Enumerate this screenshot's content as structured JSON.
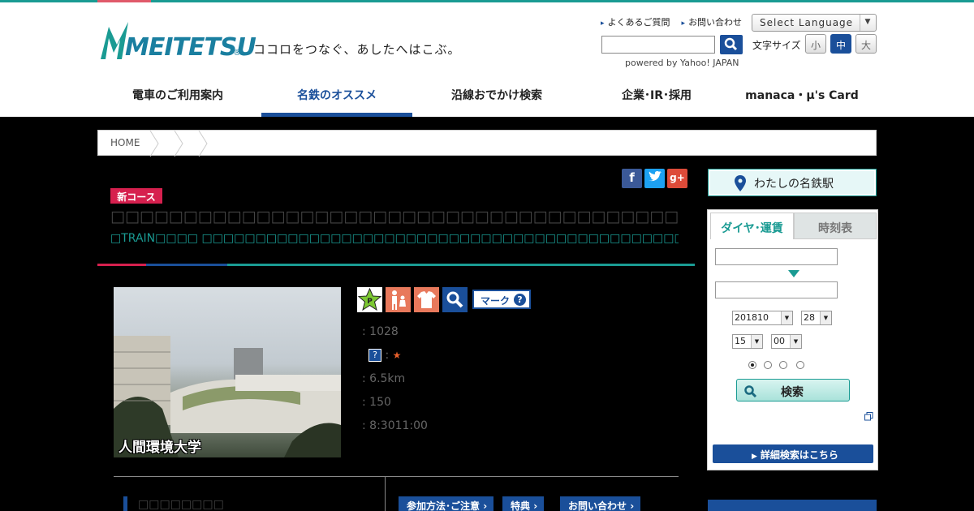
{
  "header": {
    "logo_text": "MEITETSU",
    "logo_reg": "®",
    "tagline": "ココロをつなぐ、あしたへはこぶ。",
    "links": [
      "よくあるご質問",
      "お問い合わせ"
    ],
    "language_label": "Select Language",
    "powered_by": "powered by Yahoo! JAPAN",
    "font_size_label": "文字サイズ",
    "font_sizes": [
      "小",
      "中",
      "大"
    ],
    "brand_color": "#1a4f9a",
    "accent_color": "#1a9b93"
  },
  "nav": {
    "items": [
      "電車のご利用案内",
      "名鉄のオススメ",
      "沿線おでかけ検索",
      "企業･IR･採用",
      "manaca・μ's Card"
    ],
    "active_index": 1
  },
  "breadcrumb": {
    "home": "HOME"
  },
  "course": {
    "badge": "新コース",
    "title": "□□□□□□□□□□□□□□□□□□□□□□□□□□□□□□□□□□□□□□□□□□□□□□□□□□",
    "subtitle": "□TRAIN□□□□ □□□□□□□□□□□□□□□□□□□□□□□□□□□□□□□□□□□□□□□□□□□□□□",
    "photo_caption": "人間環境大学",
    "mark_button": "マーク",
    "info": {
      "number": ": 1028",
      "rating_sep": ":",
      "rating": "★",
      "distance": ": 6.5km",
      "count": ": 150",
      "time": ": 8:3011:00"
    },
    "section_title": "□□□□□□□□",
    "tabs": [
      "参加方法･ご注意",
      "特典",
      "お問い合わせ"
    ]
  },
  "sidebar": {
    "my_station": "わたしの名鉄駅",
    "tab_active": "ダイヤ･運賃",
    "tab_inactive": "時刻表",
    "year_month": "201810",
    "day": "28",
    "hour": "15",
    "minute": "00",
    "search_label": "検索",
    "detail_label": "詳細検索はこちら"
  }
}
